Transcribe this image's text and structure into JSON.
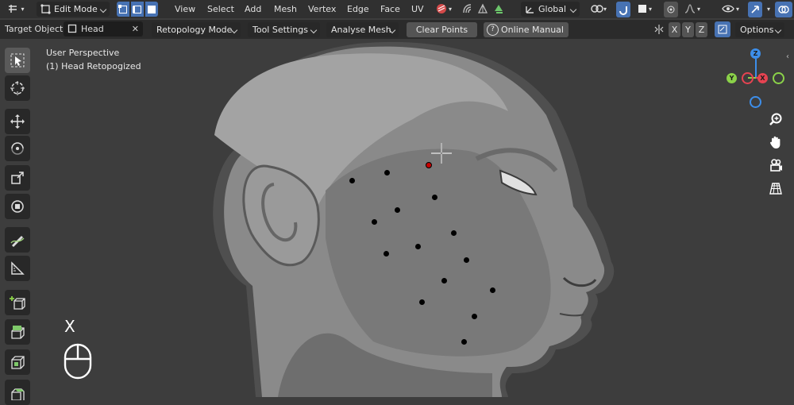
{
  "header": {
    "mode": "Edit Mode",
    "menus": [
      "View",
      "Select",
      "Add",
      "Mesh",
      "Vertex",
      "Edge",
      "Face",
      "UV"
    ],
    "transform_orientation": "Global"
  },
  "tool_options": {
    "target_object_label": "Target Object:",
    "target_object_value": "Head",
    "retopology_mode": "Retopology Mode",
    "tool_settings": "Tool Settings",
    "analyse_mesh": "Analyse Mesh",
    "clear_points": "Clear Points",
    "online_manual": "Online Manual",
    "mirror_x": "X",
    "mirror_y": "Y",
    "mirror_z": "Z",
    "options": "Options"
  },
  "viewport": {
    "perspective_label": "User Perspective",
    "object_label": "(1) Head Retopogized",
    "key_hint": "X"
  },
  "gizmo": {
    "z": "Z",
    "y": "Y",
    "x": "X"
  },
  "colors": {
    "accent": "#4772b3",
    "selected_point": "#c80000",
    "x_axis": "#e64351",
    "y_axis": "#8bd249",
    "z_axis": "#3d8eea"
  }
}
